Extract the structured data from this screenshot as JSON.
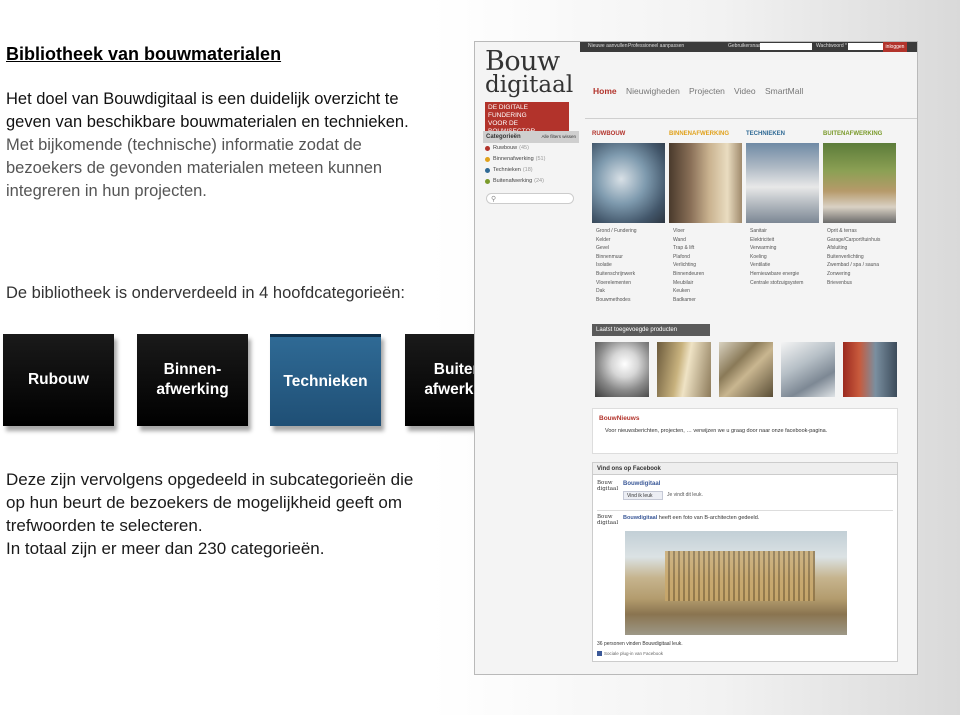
{
  "slide": {
    "title": "Bibliotheek van bouwmaterialen",
    "para1_line1": "Het doel van Bouwdigitaal is een duidelijk overzicht te",
    "para1_line2": "geven van beschikbare bouwmaterialen en technieken.",
    "para1_line3": "Met bijkomende (technische) informatie zodat de",
    "para1_line4": "bezoekers de gevonden materialen meteen kunnen",
    "para1_line5": "integreren in hun projecten.",
    "para2": "De bibliotheek is onderverdeeld in 4 hoofdcategorieën:",
    "tiles": [
      "Rubouw",
      "Binnen-\nafwerking",
      "Technieken",
      "Buiten-\nafwerking"
    ],
    "para3_line1": "Deze zijn vervolgens opgedeeld in subcategorieën die",
    "para3_line2": "op hun beurt de bezoekers de mogelijkheid geeft om",
    "para3_line3": "trefwoorden te selecteren.",
    "para3_line4": "In totaal zijn er meer dan 230 categorieën."
  },
  "site": {
    "topbar": {
      "link1": "Nieuwe aanvullen",
      "link2": "Professioneel aanpassen",
      "user_label": "Gebruikersnaam *",
      "pass_label": "Wachtwoord *",
      "login_button": "inloggen"
    },
    "logo": {
      "line1": "Bouw",
      "line2": "digitaal",
      "tagline1": "DE DIGITALE FUNDERING",
      "tagline2": "VOOR DE BOUWSECTOR"
    },
    "nav": [
      "Home",
      "Nieuwigheden",
      "Projecten",
      "Video",
      "SmartMall"
    ],
    "categories": {
      "title": "Categorieën",
      "more": "Alle filters wissen",
      "items": [
        {
          "label": "Ruwbouw",
          "count": "(45)",
          "color": "#b2332b"
        },
        {
          "label": "Binnenafwerking",
          "count": "(51)",
          "color": "#e0a11b"
        },
        {
          "label": "Technieken",
          "count": "(18)",
          "color": "#2f6a95"
        },
        {
          "label": "Buitenafwerking",
          "count": "(24)",
          "color": "#7a9a2a"
        }
      ]
    },
    "columns": [
      {
        "title": "RUWBOUW",
        "color": "#b2332b",
        "items": [
          "Grond / Fundering",
          "Kelder",
          "Gevel",
          "Binnenmuur",
          "Isolatie",
          "Buitenschrijnwerk",
          "Vloerelementen",
          "Dak",
          "Bouwmethodes"
        ]
      },
      {
        "title": "BINNENAFWERKING",
        "color": "#e0a11b",
        "items": [
          "Vloer",
          "Wand",
          "Trap & lift",
          "Plafond",
          "Verlichting",
          "Binnendeuren",
          "Meubilair",
          "Keuken",
          "Badkamer"
        ]
      },
      {
        "title": "TECHNIEKEN",
        "color": "#2f6a95",
        "items": [
          "Sanitair",
          "Elektriciteit",
          "Verwarming",
          "Koeling",
          "Ventilatie",
          "Hernieuwbare energie",
          "Centrale stofzuigsystem"
        ]
      },
      {
        "title": "BUITENAFWERKING",
        "color": "#7a9a2a",
        "items": [
          "Oprit & terras",
          "Garage/Carport/tuinhuis",
          "Afsluiting",
          "Buitenverlichting",
          "Zwembad / spa / sauna",
          "Zonwering",
          "Brievenbus"
        ]
      }
    ],
    "recent_title": "Laatst toegevoegde producten",
    "news": {
      "title": "BouwNieuws",
      "text": "Voor nieuwsberichten, projecten, … verwijzen we u graag door naar onze facebook-pagina."
    },
    "facebook": {
      "header": "Vind ons op Facebook",
      "page_name": "Bouwdigitaal",
      "like_button": "Vind ik leuk",
      "likes_text": "Je vindt dit leuk.",
      "logo_line1": "Bouw",
      "logo_line2": "digitaal",
      "post_author": "Bouwdigitaal",
      "post_text": "heeft een foto van B-architecten gedeeld.",
      "count_text": "36 personen vinden Bouwdigitaal leuk.",
      "footer": "Sociale plug-in van Facebook"
    }
  }
}
